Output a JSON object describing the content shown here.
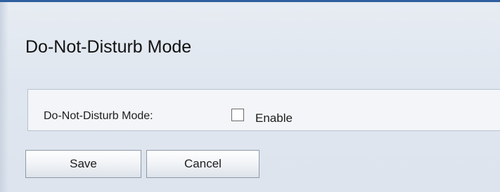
{
  "page": {
    "title": "Do-Not-Disturb Mode"
  },
  "form": {
    "dnd_label": "Do-Not-Disturb Mode:",
    "enable_label": "Enable",
    "enable_checked": false
  },
  "actions": {
    "save_label": "Save",
    "cancel_label": "Cancel"
  },
  "colors": {
    "accent_bar": "#2f5f9e",
    "background": "#dfe6ef"
  }
}
